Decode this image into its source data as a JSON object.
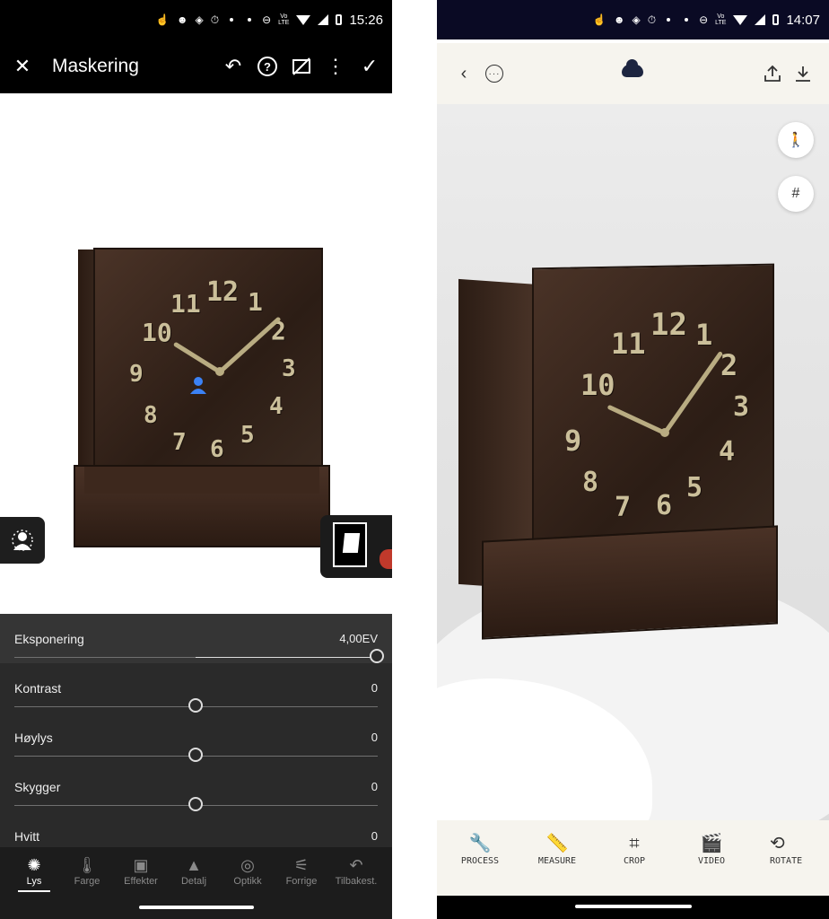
{
  "left": {
    "status": {
      "time": "15:26"
    },
    "toolbar": {
      "title": "Maskering"
    },
    "icons": {
      "close": "close-icon",
      "undo": "undo-icon",
      "help": "help-icon",
      "mask_overlay": "mask-overlay-icon",
      "more": "more-icon",
      "confirm": "check-icon"
    },
    "clock_numerals": [
      "12",
      "1",
      "2",
      "3",
      "4",
      "5",
      "6",
      "7",
      "8",
      "9",
      "10",
      "11"
    ],
    "panel": {
      "rows": [
        {
          "label": "Eksponering",
          "value": "4,00EV",
          "position": 1.0
        },
        {
          "label": "Kontrast",
          "value": "0",
          "position": 0.5
        },
        {
          "label": "Høylys",
          "value": "0",
          "position": 0.5
        },
        {
          "label": "Skygger",
          "value": "0",
          "position": 0.5
        },
        {
          "label": "Hvitt",
          "value": "0",
          "position": 0.5
        }
      ]
    },
    "tabs": [
      {
        "label": "Lys",
        "icon": "sun-icon",
        "active": true
      },
      {
        "label": "Farge",
        "icon": "thermometer-icon",
        "active": false
      },
      {
        "label": "Effekter",
        "icon": "vignette-icon",
        "active": false
      },
      {
        "label": "Detalj",
        "icon": "triangle-icon",
        "active": false
      },
      {
        "label": "Optikk",
        "icon": "lens-icon",
        "active": false
      },
      {
        "label": "Forrige",
        "icon": "sliders-icon",
        "active": false
      },
      {
        "label": "Tilbakest.",
        "icon": "reset-icon",
        "active": false
      }
    ]
  },
  "right": {
    "status": {
      "time": "14:07"
    },
    "icons": {
      "back": "back-chevron-icon",
      "more": "more-circle-icon",
      "cloud": "cloud-icon",
      "share": "share-icon",
      "download": "download-icon",
      "walk": "walk-icon",
      "grid": "grid-icon"
    },
    "clock_numerals": [
      "12",
      "1",
      "2",
      "3",
      "4",
      "5",
      "6",
      "7",
      "8",
      "9",
      "10",
      "11"
    ],
    "tabs": [
      {
        "label": "PROCESS",
        "icon": "wrench-icon"
      },
      {
        "label": "MEASURE",
        "icon": "ruler-icon"
      },
      {
        "label": "CROP",
        "icon": "crop-icon"
      },
      {
        "label": "VIDEO",
        "icon": "clapper-icon"
      },
      {
        "label": "ROTATE",
        "icon": "rotate-icon"
      }
    ]
  }
}
